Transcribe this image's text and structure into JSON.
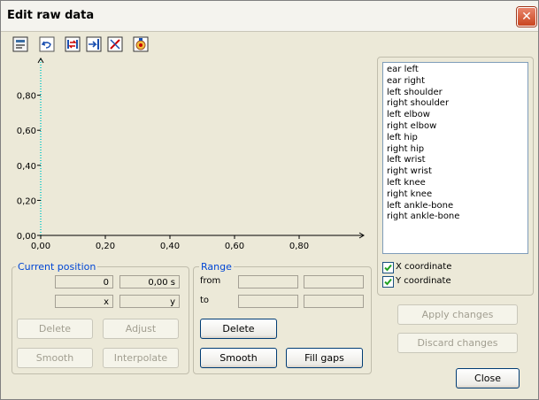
{
  "window": {
    "title": "Edit raw data",
    "close_glyph": "✕"
  },
  "toolbar": {
    "icons": [
      "properties-icon",
      "undo-icon",
      "import-icon",
      "export-icon",
      "remove-icon",
      "settings-icon"
    ]
  },
  "chart_data": {
    "type": "line",
    "x_ticks": [
      "0,00",
      "0,20",
      "0,40",
      "0,60",
      "0,80"
    ],
    "y_ticks": [
      "0,00",
      "0,20",
      "0,40",
      "0,60",
      "0,80"
    ],
    "xlim": [
      0,
      1
    ],
    "ylim": [
      0,
      1
    ],
    "series": []
  },
  "points": {
    "items": [
      "ear left",
      "ear right",
      "left shoulder",
      "right shoulder",
      "left elbow",
      "right elbow",
      "left hip",
      "right hip",
      "left wrist",
      "right wrist",
      "left knee",
      "right knee",
      "left ankle-bone",
      "right ankle-bone"
    ],
    "x_coordinate_label": "X coordinate",
    "y_coordinate_label": "Y coordinate",
    "x_checked": true,
    "y_checked": true
  },
  "current_position": {
    "legend": "Current position",
    "frame_value": "0",
    "time_value": "0,00 s",
    "x_value": "x",
    "y_value": "y",
    "delete_label": "Delete",
    "adjust_label": "Adjust",
    "smooth_label": "Smooth",
    "interpolate_label": "Interpolate"
  },
  "range": {
    "legend": "Range",
    "from_label": "from",
    "to_label": "to",
    "delete_label": "Delete",
    "smooth_label": "Smooth",
    "fill_gaps_label": "Fill gaps"
  },
  "actions": {
    "apply_label": "Apply changes",
    "discard_label": "Discard changes",
    "close_label": "Close"
  },
  "colors": {
    "axis": "#000000",
    "y_axis_dotted": "#00c8c8",
    "legend_text": "#0046d5"
  }
}
